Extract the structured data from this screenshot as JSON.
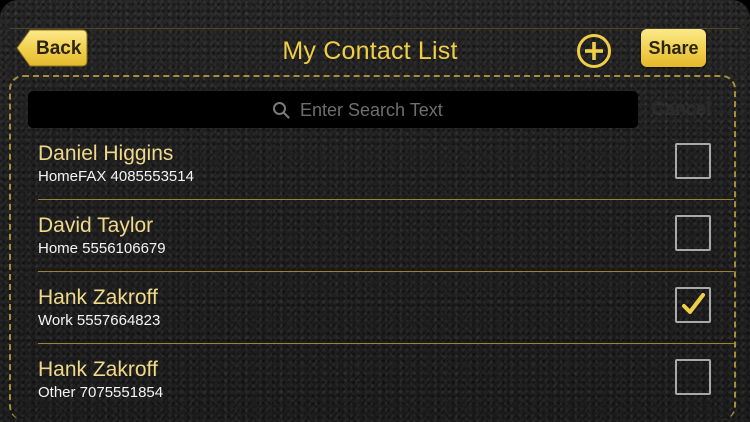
{
  "nav": {
    "back_label": "Back",
    "title": "My Contact List",
    "share_label": "Share",
    "add_icon": "plus-circle-icon"
  },
  "search": {
    "placeholder": "Enter Search Text",
    "value": "",
    "cancel_label": "Cancel"
  },
  "colors": {
    "accent_gold": "#f1cf45",
    "name_text": "#f0da8a",
    "leather": "#1f1f1f"
  },
  "contacts": [
    {
      "name": "Daniel Higgins",
      "detail": "HomeFAX 4085553514",
      "checked": false
    },
    {
      "name": "David Taylor",
      "detail": "Home 5556106679",
      "checked": false
    },
    {
      "name": "Hank Zakroff",
      "detail": "Work 5557664823",
      "checked": true
    },
    {
      "name": "Hank Zakroff",
      "detail": "Other 7075551854",
      "checked": false
    }
  ]
}
